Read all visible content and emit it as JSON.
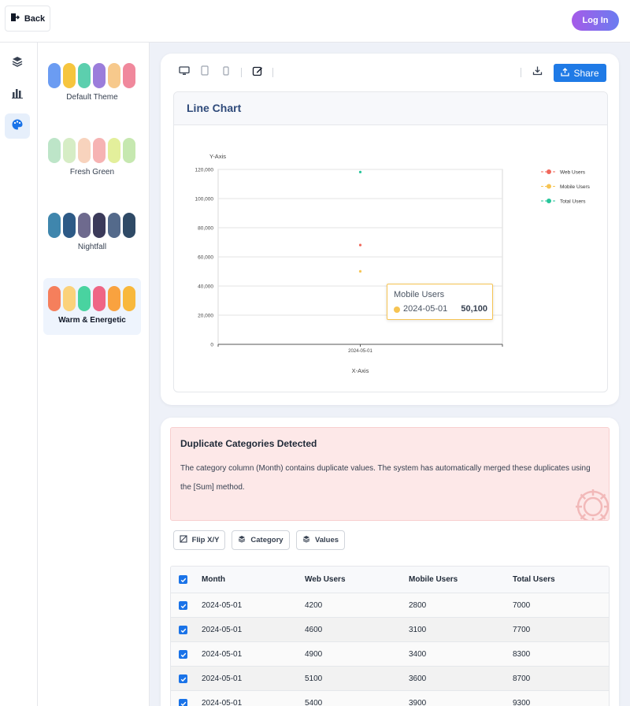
{
  "header": {
    "back_label": "Back",
    "login_label": "Log In"
  },
  "rail": {
    "items": [
      "layers-icon",
      "bar-chart-icon",
      "palette-icon"
    ],
    "active": "palette-icon"
  },
  "themes": [
    {
      "label": "Default Theme",
      "selected": false,
      "colors": [
        "#6b9cf2",
        "#f6c53e",
        "#5ccfae",
        "#9b7ddb",
        "#f7c98c",
        "#f0889c"
      ]
    },
    {
      "label": "Fresh Green",
      "selected": false,
      "colors": [
        "#bde5c8",
        "#d6edc5",
        "#f8d3bd",
        "#f6b3b3",
        "#e3ef9b",
        "#c6e8b0"
      ]
    },
    {
      "label": "Nightfall",
      "selected": false,
      "colors": [
        "#3f86ad",
        "#2d5a86",
        "#6e6a8e",
        "#3b3a5a",
        "#546a8b",
        "#2f4a66"
      ]
    },
    {
      "label": "Warm & Energetic",
      "selected": true,
      "colors": [
        "#f57f5c",
        "#fbd27a",
        "#49d3a0",
        "#ef6585",
        "#f9a23f",
        "#f8b83c"
      ]
    }
  ],
  "toolbar": {
    "share_label": "Share",
    "icons": [
      "desktop-icon",
      "tablet-icon",
      "mobile-icon",
      "edit-icon",
      "download-icon",
      "share-icon"
    ]
  },
  "chart_data": {
    "type": "line",
    "title": "Line Chart",
    "xlabel": "X-Axis",
    "ylabel": "Y-Axis",
    "categories": [
      "2024-05-01"
    ],
    "ylim": [
      0,
      120000
    ],
    "yticks": [
      "0",
      "20,000",
      "40,000",
      "60,000",
      "80,000",
      "100,000",
      "120,000"
    ],
    "series": [
      {
        "name": "Web Users",
        "color": "#f0675b",
        "values": [
          68100
        ]
      },
      {
        "name": "Mobile Users",
        "color": "#f6c453",
        "values": [
          50100
        ]
      },
      {
        "name": "Total Users",
        "color": "#27c59a",
        "values": [
          118200
        ]
      }
    ],
    "legend": "top-right",
    "grid": true
  },
  "tooltip": {
    "series": "Mobile Users",
    "x": "2024-05-01",
    "value": "50,100"
  },
  "alert": {
    "title": "Duplicate Categories Detected",
    "message": "The category column (Month) contains duplicate values. The system has automatically merged these duplicates using the [Sum] method."
  },
  "controls": {
    "flip_label": "Flip X/Y",
    "category_label": "Category",
    "values_label": "Values"
  },
  "table": {
    "columns": [
      "Month",
      "Web Users",
      "Mobile Users",
      "Total Users"
    ],
    "rows": [
      [
        "2024-05-01",
        "4200",
        "2800",
        "7000"
      ],
      [
        "2024-05-01",
        "4600",
        "3100",
        "7700"
      ],
      [
        "2024-05-01",
        "4900",
        "3400",
        "8300"
      ],
      [
        "2024-05-01",
        "5100",
        "3600",
        "8700"
      ],
      [
        "2024-05-01",
        "5400",
        "3900",
        "9300"
      ]
    ]
  }
}
